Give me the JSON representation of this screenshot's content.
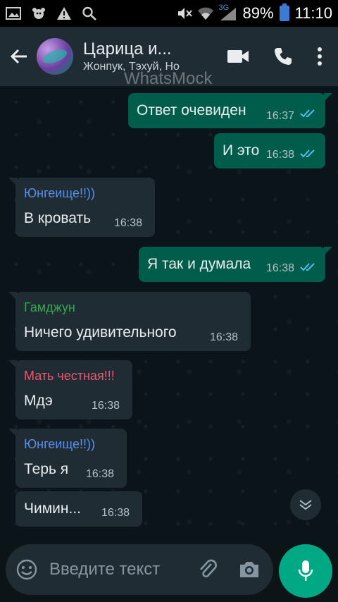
{
  "status_bar": {
    "battery": "89%",
    "time": "11:10",
    "network": "3G",
    "icons": [
      "gallery-icon",
      "bear-icon",
      "warning-icon",
      "search-icon",
      "mute-icon",
      "wifi-icon",
      "signal-icon",
      "battery-icon"
    ]
  },
  "header": {
    "title": "Царица и...",
    "subtitle": "Жонпук, Тэхуй, Но",
    "watermark": "WhatsMock",
    "actions": [
      "video-call-icon",
      "voice-call-icon",
      "more-icon"
    ]
  },
  "messages": [
    {
      "direction": "out",
      "text": "Ответ очевиден",
      "time": "16:37",
      "status": "read"
    },
    {
      "direction": "out",
      "text": "И это",
      "time": "16:38",
      "status": "read"
    },
    {
      "direction": "in",
      "sender": "Юнгеище!!))",
      "sender_color": "#5b8ee5",
      "text": "В кровать",
      "time": "16:38"
    },
    {
      "direction": "out",
      "text": "Я так и думала",
      "time": "16:38",
      "status": "read"
    },
    {
      "direction": "in",
      "sender": "Гамджун",
      "sender_color": "#35a84e",
      "text": "Ничего удивительного",
      "time": "16:38"
    },
    {
      "direction": "in",
      "sender": "Мать честная!!!",
      "sender_color": "#ef5470",
      "text": "Мдэ",
      "time": "16:38"
    },
    {
      "direction": "in",
      "sender": "Юнгеище!!))",
      "sender_color": "#5b8ee5",
      "text": "Терь я",
      "time": "16:38"
    },
    {
      "direction": "in",
      "text": "Чимин...",
      "time": "16:38"
    }
  ],
  "composer": {
    "placeholder": "Введите текст"
  },
  "colors": {
    "outgoing_bubble": "#005c4b",
    "incoming_bubble": "#202c33",
    "read_ticks": "#53bdeb",
    "accent": "#00a884"
  }
}
